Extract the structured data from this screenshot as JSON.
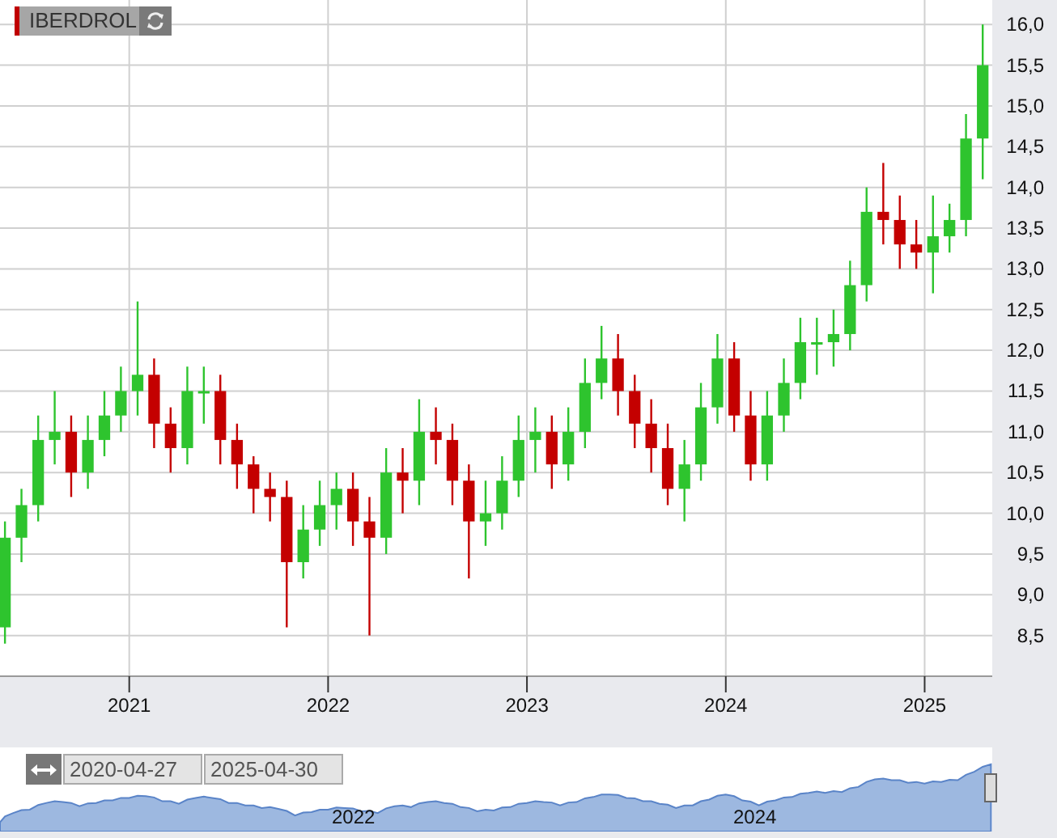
{
  "ticker": {
    "symbol": "IBERDROL"
  },
  "chart_data": {
    "type": "candlestick",
    "grid": true,
    "x": [
      2020.375,
      2020.458,
      2020.542,
      2020.625,
      2020.708,
      2020.792,
      2020.875,
      2020.958,
      2021.042,
      2021.125,
      2021.208,
      2021.292,
      2021.375,
      2021.458,
      2021.542,
      2021.625,
      2021.708,
      2021.792,
      2021.875,
      2021.958,
      2022.042,
      2022.125,
      2022.208,
      2022.292,
      2022.375,
      2022.458,
      2022.542,
      2022.625,
      2022.708,
      2022.792,
      2022.875,
      2022.958,
      2023.042,
      2023.125,
      2023.208,
      2023.292,
      2023.375,
      2023.458,
      2023.542,
      2023.625,
      2023.708,
      2023.792,
      2023.875,
      2023.958,
      2024.042,
      2024.125,
      2024.208,
      2024.292,
      2024.375,
      2024.458,
      2024.542,
      2024.625,
      2024.708,
      2024.792,
      2024.875,
      2024.958,
      2025.042,
      2025.125,
      2025.208,
      2025.292
    ],
    "ohlc": [
      [
        8.6,
        9.9,
        8.4,
        9.7
      ],
      [
        9.7,
        10.3,
        9.4,
        10.1
      ],
      [
        10.1,
        11.2,
        9.9,
        10.9
      ],
      [
        10.9,
        11.5,
        10.6,
        11.0
      ],
      [
        11.0,
        11.2,
        10.2,
        10.5
      ],
      [
        10.5,
        11.2,
        10.3,
        10.9
      ],
      [
        10.9,
        11.5,
        10.7,
        11.2
      ],
      [
        11.2,
        11.8,
        11.0,
        11.5
      ],
      [
        11.5,
        12.6,
        11.2,
        11.7
      ],
      [
        11.7,
        11.9,
        10.8,
        11.1
      ],
      [
        11.1,
        11.3,
        10.5,
        10.8
      ],
      [
        10.8,
        11.8,
        10.6,
        11.5
      ],
      [
        11.5,
        11.8,
        11.1,
        11.5
      ],
      [
        11.5,
        11.7,
        10.6,
        10.9
      ],
      [
        10.9,
        11.1,
        10.3,
        10.6
      ],
      [
        10.6,
        10.7,
        10.0,
        10.3
      ],
      [
        10.3,
        10.5,
        9.9,
        10.2
      ],
      [
        10.2,
        10.4,
        8.6,
        9.4
      ],
      [
        9.4,
        10.1,
        9.2,
        9.8
      ],
      [
        9.8,
        10.4,
        9.6,
        10.1
      ],
      [
        10.1,
        10.5,
        9.8,
        10.3
      ],
      [
        10.3,
        10.5,
        9.6,
        9.9
      ],
      [
        9.9,
        10.2,
        8.5,
        9.7
      ],
      [
        9.7,
        10.8,
        9.5,
        10.5
      ],
      [
        10.5,
        10.8,
        10.0,
        10.4
      ],
      [
        10.4,
        11.4,
        10.1,
        11.0
      ],
      [
        11.0,
        11.3,
        10.6,
        10.9
      ],
      [
        10.9,
        11.1,
        10.1,
        10.4
      ],
      [
        10.4,
        10.6,
        9.2,
        9.9
      ],
      [
        9.9,
        10.4,
        9.6,
        10.0
      ],
      [
        10.0,
        10.7,
        9.8,
        10.4
      ],
      [
        10.4,
        11.2,
        10.2,
        10.9
      ],
      [
        10.9,
        11.3,
        10.5,
        11.0
      ],
      [
        11.0,
        11.2,
        10.3,
        10.6
      ],
      [
        10.6,
        11.3,
        10.4,
        11.0
      ],
      [
        11.0,
        11.9,
        10.8,
        11.6
      ],
      [
        11.6,
        12.3,
        11.4,
        11.9
      ],
      [
        11.9,
        12.2,
        11.2,
        11.5
      ],
      [
        11.5,
        11.7,
        10.8,
        11.1
      ],
      [
        11.1,
        11.4,
        10.5,
        10.8
      ],
      [
        10.8,
        11.1,
        10.1,
        10.3
      ],
      [
        10.3,
        10.9,
        9.9,
        10.6
      ],
      [
        10.6,
        11.6,
        10.4,
        11.3
      ],
      [
        11.3,
        12.2,
        11.1,
        11.9
      ],
      [
        11.9,
        12.1,
        11.0,
        11.2
      ],
      [
        11.2,
        11.5,
        10.4,
        10.6
      ],
      [
        10.6,
        11.5,
        10.4,
        11.2
      ],
      [
        11.2,
        11.9,
        11.0,
        11.6
      ],
      [
        11.6,
        12.4,
        11.4,
        12.1
      ],
      [
        12.1,
        12.4,
        11.7,
        12.1
      ],
      [
        12.1,
        12.5,
        11.8,
        12.2
      ],
      [
        12.2,
        13.1,
        12.0,
        12.8
      ],
      [
        12.8,
        14.0,
        12.6,
        13.7
      ],
      [
        13.7,
        14.3,
        13.3,
        13.6
      ],
      [
        13.6,
        13.9,
        13.0,
        13.3
      ],
      [
        13.3,
        13.6,
        13.0,
        13.2
      ],
      [
        13.2,
        13.9,
        12.7,
        13.4
      ],
      [
        13.4,
        13.8,
        13.2,
        13.6
      ],
      [
        13.6,
        14.9,
        13.4,
        14.6
      ],
      [
        14.6,
        16.0,
        14.1,
        15.5
      ]
    ],
    "xlim": [
      2020.35,
      2025.34
    ],
    "ylim": [
      8.0,
      16.3
    ],
    "yticks": [
      {
        "value": 16.0,
        "label": "16,0"
      },
      {
        "value": 15.5,
        "label": "15,5"
      },
      {
        "value": 15.0,
        "label": "15,0"
      },
      {
        "value": 14.5,
        "label": "14,5"
      },
      {
        "value": 14.0,
        "label": "14,0"
      },
      {
        "value": 13.5,
        "label": "13,5"
      },
      {
        "value": 13.0,
        "label": "13,0"
      },
      {
        "value": 12.5,
        "label": "12,5"
      },
      {
        "value": 12.0,
        "label": "12,0"
      },
      {
        "value": 11.5,
        "label": "11,5"
      },
      {
        "value": 11.0,
        "label": "11,0"
      },
      {
        "value": 10.5,
        "label": "10,5"
      },
      {
        "value": 10.0,
        "label": "10,0"
      },
      {
        "value": 9.5,
        "label": "9,5"
      },
      {
        "value": 9.0,
        "label": "9,0"
      },
      {
        "value": 8.5,
        "label": "8,5"
      }
    ],
    "xticks": [
      {
        "value": 2021,
        "label": "2021"
      },
      {
        "value": 2022,
        "label": "2022"
      },
      {
        "value": 2023,
        "label": "2023"
      },
      {
        "value": 2024,
        "label": "2024"
      },
      {
        "value": 2025,
        "label": "2025"
      }
    ]
  },
  "navigator": {
    "from": "2020-04-27",
    "to": "2025-04-30",
    "year_labels": [
      "2022",
      "2024"
    ]
  }
}
